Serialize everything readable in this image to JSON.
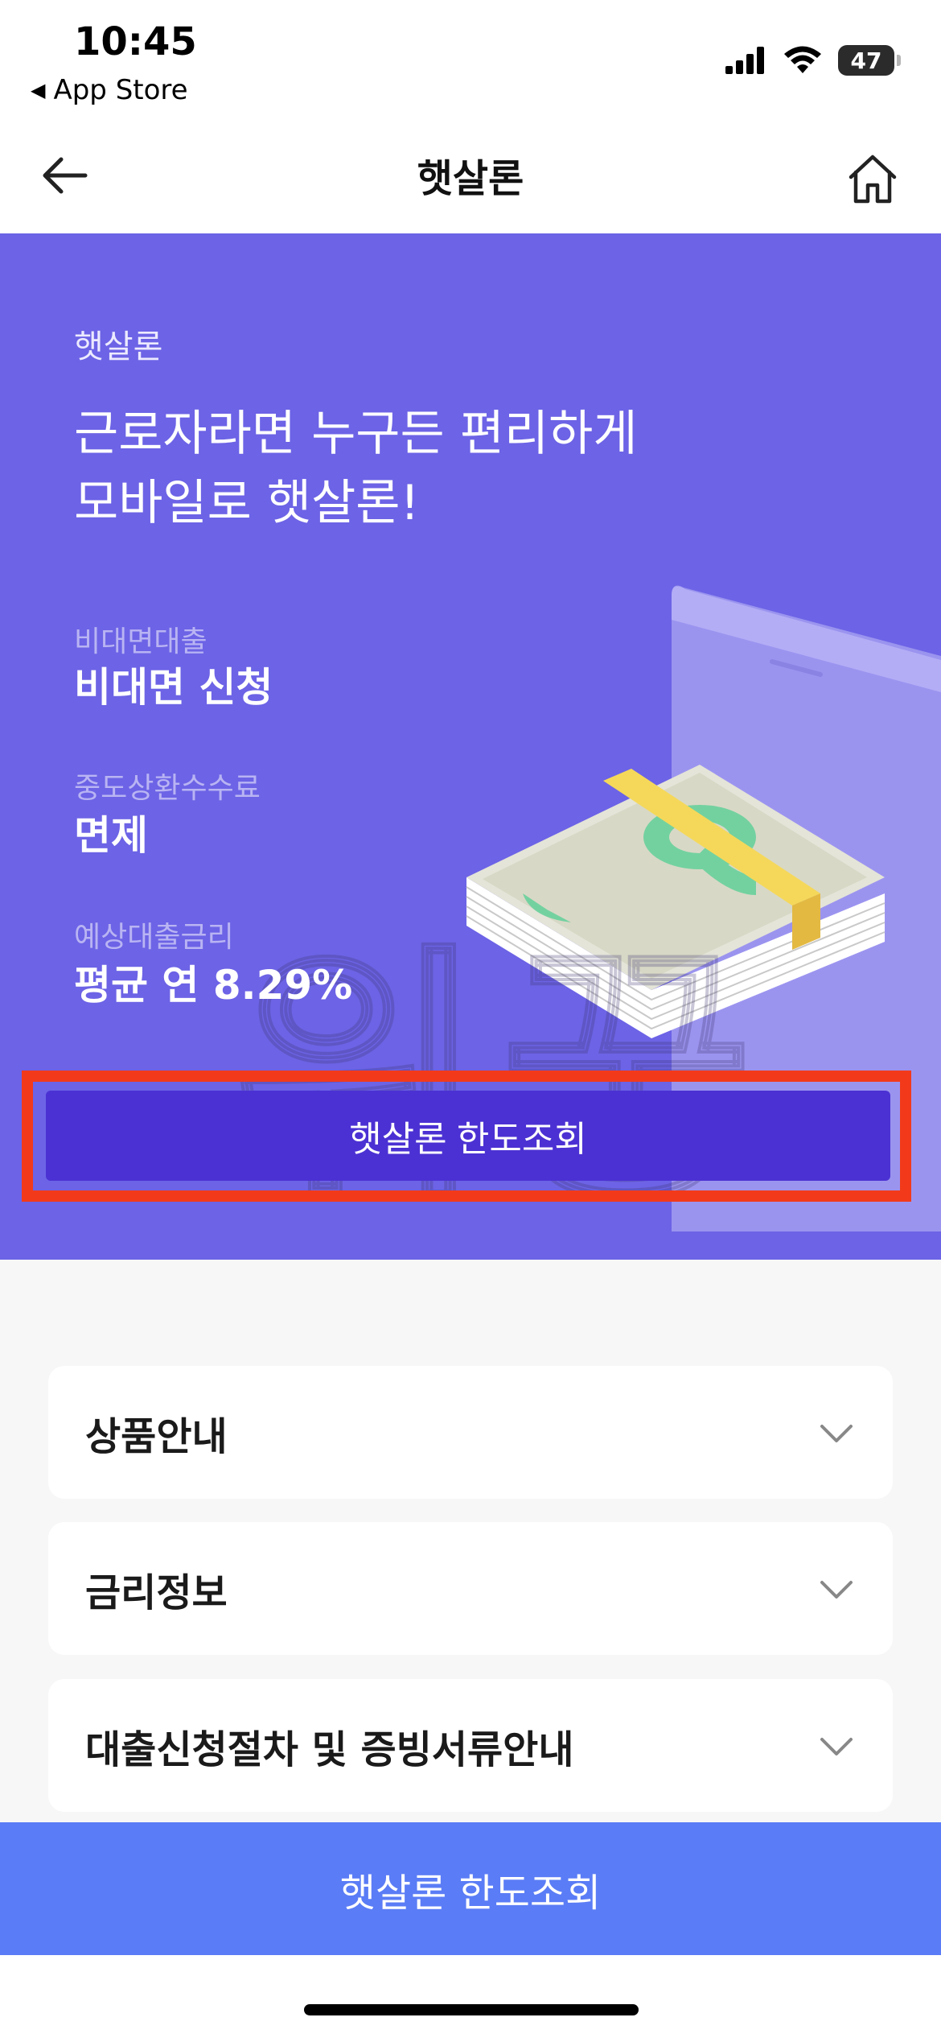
{
  "status_bar": {
    "time": "10:45",
    "back_app": "App Store",
    "battery": "47",
    "signal_icon": "cellular-signal-icon",
    "wifi_icon": "wifi-icon"
  },
  "nav": {
    "title": "햇살론",
    "back_icon": "arrow-left-icon",
    "home_icon": "home-icon"
  },
  "hero": {
    "eyebrow": "햇살론",
    "headline_line1": "근로자라면 누구든 편리하게",
    "headline_line2": "모바일로 햇살론!",
    "info": [
      {
        "label": "비대면대출",
        "value": "비대면 신청"
      },
      {
        "label": "중도상환수수료",
        "value": "면제"
      },
      {
        "label": "예상대출금리",
        "value": "평균 연 8.29%"
      }
    ],
    "cta_label": "햇살론 한도조회",
    "illustration": "money-stack-icon",
    "watermark": "워꿍"
  },
  "accordion": [
    {
      "label": "상품안내",
      "icon": "chevron-down-icon"
    },
    {
      "label": "금리정보",
      "icon": "chevron-down-icon"
    },
    {
      "label": "대출신청절차 및 증빙서류안내",
      "icon": "chevron-down-icon"
    }
  ],
  "bottom_cta": {
    "label": "햇살론 한도조회"
  },
  "colors": {
    "hero_bg": "#6c63e6",
    "hero_cta": "#4b31d3",
    "highlight": "#f23a1b",
    "bottom_cta": "#5a7cf6"
  }
}
